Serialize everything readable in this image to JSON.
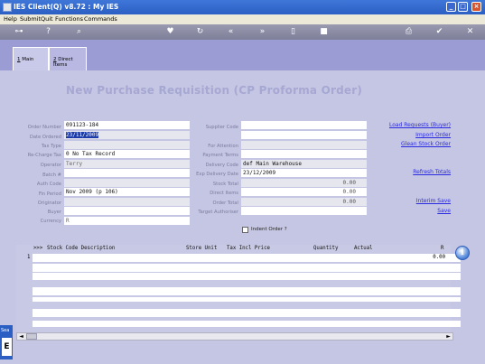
{
  "window": {
    "title": "IES Client(Q) v8.72 : My IES",
    "controls": [
      "_",
      "□",
      "×"
    ]
  },
  "menu": [
    "Help",
    "Submit",
    "Quit",
    "Functions",
    "Commands"
  ],
  "toolbar_icons": [
    "key-icon",
    "help-icon",
    "search-icon",
    "heart-icon",
    "refresh-icon",
    "rewind-icon",
    "fast-forward-icon",
    "page-icon",
    "stop-icon",
    "printer-icon",
    "check-icon",
    "close-icon"
  ],
  "tabs": [
    {
      "num": "1",
      "label": "Main"
    },
    {
      "num": "2",
      "label": "Direct Items"
    }
  ],
  "page_title": "New Purchase Requisition (CP Proforma Order)",
  "left_fields": {
    "order_number": {
      "label": "Order Number",
      "value": "091123-184"
    },
    "date_ordered": {
      "label": "Date Ordered",
      "value": "23/11/2009"
    },
    "tax_type": {
      "label": "Tax Type",
      "value": ""
    },
    "re_charge_tax": {
      "label": "Re-Charge Tax",
      "value": "0 No Tax Record"
    },
    "operator": {
      "label": "Operator",
      "value": "Terry"
    },
    "batch": {
      "label": "Batch #",
      "value": ""
    },
    "auth_code": {
      "label": "Auth Code",
      "value": ""
    },
    "fin_period": {
      "label": "Fin Period",
      "value": "Nov 2009 (p 106)"
    },
    "originator": {
      "label": "Originator",
      "value": ""
    },
    "buyer": {
      "label": "Buyer",
      "value": ""
    },
    "currency": {
      "label": "Currency",
      "value": "R"
    }
  },
  "right_fields": {
    "supplier_code": {
      "label": "Supplier Code",
      "value": ""
    },
    "blank": {
      "label": "",
      "value": ""
    },
    "for_attention": {
      "label": "For Attention",
      "value": ""
    },
    "payment_terms": {
      "label": "Payment Terms",
      "value": ""
    },
    "delivery_code": {
      "label": "Delivery Code",
      "value": "def Main Warehouse"
    },
    "exp_delivery_date": {
      "label": "Exp Delivery Date",
      "value": "23/12/2009"
    },
    "stock_total": {
      "label": "Stock Total",
      "value": "0.00"
    },
    "direct_items": {
      "label": "Direct Items",
      "value": "0.00"
    },
    "order_total": {
      "label": "Order Total",
      "value": "0.00"
    },
    "target_authoriser": {
      "label": "Target Authoriser",
      "value": ""
    }
  },
  "indent_order": {
    "label": "Indent Order ?",
    "checked": false
  },
  "links": {
    "load_requests": "Load Requests (Buyer)",
    "import_order": "Import Order",
    "glean_stock_order": "Glean Stock Order",
    "refresh_totals": "Refresh Totals",
    "interim_save": "Interim Save",
    "save": "Save"
  },
  "grid": {
    "marker": ">>>",
    "columns": [
      "Stock Code Description",
      "Store Unit",
      "Tax Incl Price",
      "Quantity",
      "Actual",
      "R"
    ],
    "rows": [
      {
        "num": "1",
        "value": "0.00"
      }
    ]
  },
  "left_stub": {
    "top": "Sea",
    "big": "E"
  }
}
